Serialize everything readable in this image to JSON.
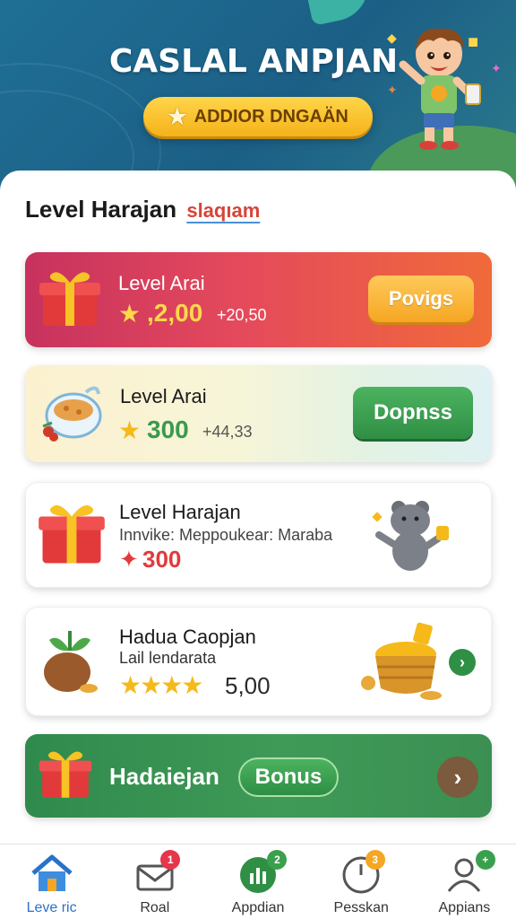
{
  "header": {
    "title": "CASLAL ANPJAN",
    "button_label": "ADDIOR DNGAÄN"
  },
  "section": {
    "title": "Level Harajan",
    "subtitle": "slaqıam"
  },
  "cards": [
    {
      "title": "Level Arai",
      "value": "2,00",
      "secondary": "+20,50",
      "button_label": "Povigs",
      "icon": "gift-box-icon",
      "accent": "#e4495c"
    },
    {
      "title": "Level Arai",
      "value": "300",
      "secondary": "+44,33",
      "button_label": "Dopnss",
      "icon": "food-bowl-icon",
      "accent": "#3a9a4f"
    },
    {
      "title": "Level Harajan",
      "subtitle": "Innvike: Meppoukear: Maraba",
      "value": "300",
      "icon": "gift-box-icon",
      "side_icon": "bear-mascot-icon"
    },
    {
      "title": "Hadua Caopjan",
      "subtitle": "Lail lendarata",
      "rating": 4,
      "value": "5,00",
      "icon": "plant-pot-icon",
      "side_icon": "coin-basket-icon"
    },
    {
      "title": "Hadaiejan",
      "pill_label": "Bonus",
      "icon": "gift-box-icon"
    }
  ],
  "nav": [
    {
      "label": "Leve ric",
      "icon": "home-icon",
      "active": true
    },
    {
      "label": "Roal",
      "icon": "mail-icon",
      "badge": "1",
      "badge_color": "#e5364a"
    },
    {
      "label": "Appdian",
      "icon": "chart-icon",
      "badge": "2",
      "badge_color": "#3aa04e"
    },
    {
      "label": "Pesskan",
      "icon": "clock-icon",
      "badge": "3",
      "badge_color": "#f5a623"
    },
    {
      "label": "Appians",
      "icon": "profile-icon",
      "badge": "+",
      "badge_color": "#3aa04e"
    }
  ],
  "colors": {
    "header_bg": "#1f6f95",
    "accent_orange": "#f5a623",
    "accent_green": "#2f8f45",
    "accent_red": "#e4495c"
  }
}
